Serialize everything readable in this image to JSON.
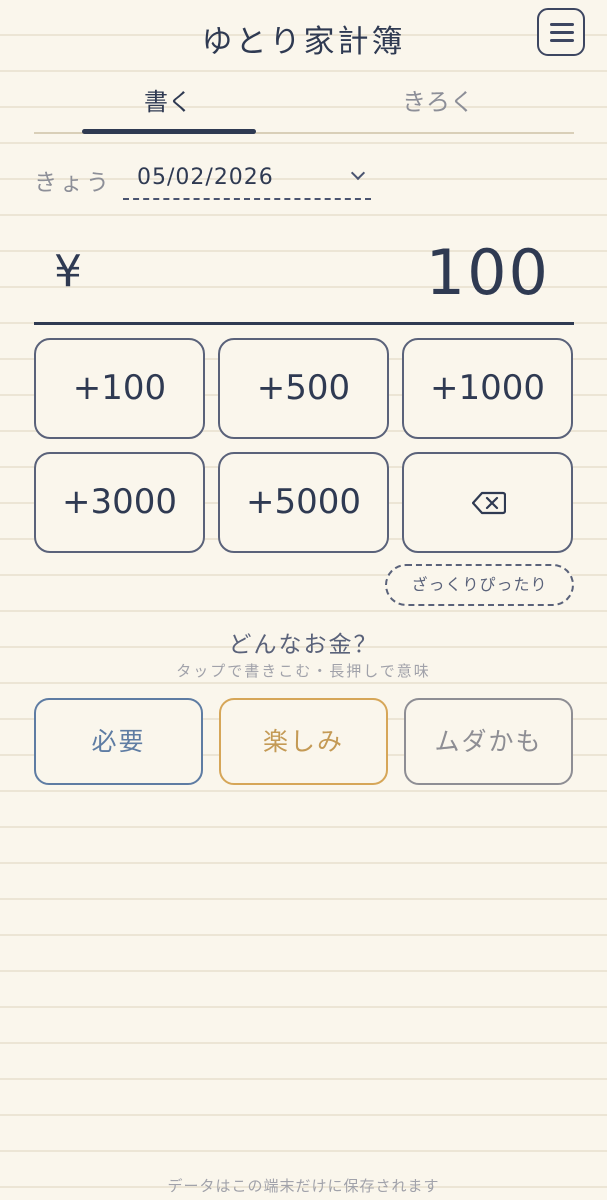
{
  "header": {
    "title": "ゆとり家計簿",
    "menu_icon": "hamburger-menu-icon"
  },
  "tabs": [
    {
      "label": "書く",
      "active": true
    },
    {
      "label": "きろく",
      "active": false
    }
  ],
  "date": {
    "label": "きょう",
    "value": "05/02/2026",
    "dropdown_icon": "chevron-down-icon"
  },
  "amount": {
    "currency": "¥",
    "value": "100"
  },
  "keypad": {
    "keys": [
      "+100",
      "+500",
      "+1000",
      "+3000",
      "+5000"
    ],
    "backspace_icon": "backspace-icon"
  },
  "rough_button": "ざっくりぴったり",
  "category_prompt": {
    "question": "どんなお金？",
    "hint": "タップで書きこむ・長押しで意味"
  },
  "categories": [
    {
      "label": "必要",
      "color": "#5e7ca3"
    },
    {
      "label": "楽しみ",
      "color": "#d6a658"
    },
    {
      "label": "ムダかも",
      "color": "#8e8e94"
    }
  ],
  "footer": "データはこの端末だけに保存されます",
  "colors": {
    "background": "#faf6ec",
    "ink": "#2f3a52",
    "ruled_line": "#ece5d5"
  }
}
